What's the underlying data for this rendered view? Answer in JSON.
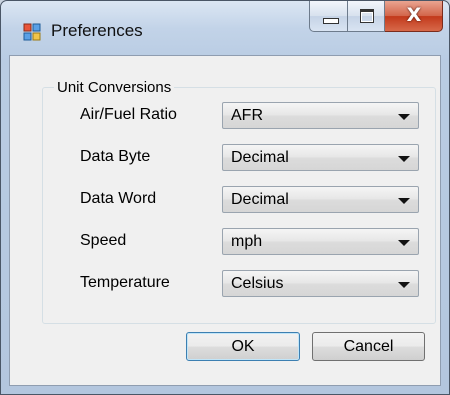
{
  "window": {
    "title": "Preferences"
  },
  "caption_buttons": {
    "close_glyph": "X"
  },
  "group": {
    "label": "Unit Conversions"
  },
  "rows": [
    {
      "label": "Air/Fuel Ratio",
      "value": "AFR"
    },
    {
      "label": "Data Byte",
      "value": "Decimal"
    },
    {
      "label": "Data Word",
      "value": "Decimal"
    },
    {
      "label": "Speed",
      "value": "mph"
    },
    {
      "label": "Temperature",
      "value": "Celsius"
    }
  ],
  "buttons": {
    "ok": "OK",
    "cancel": "Cancel"
  },
  "colors": {
    "close_button": "#c2391b",
    "default_button_border": "#3c7fb1"
  }
}
